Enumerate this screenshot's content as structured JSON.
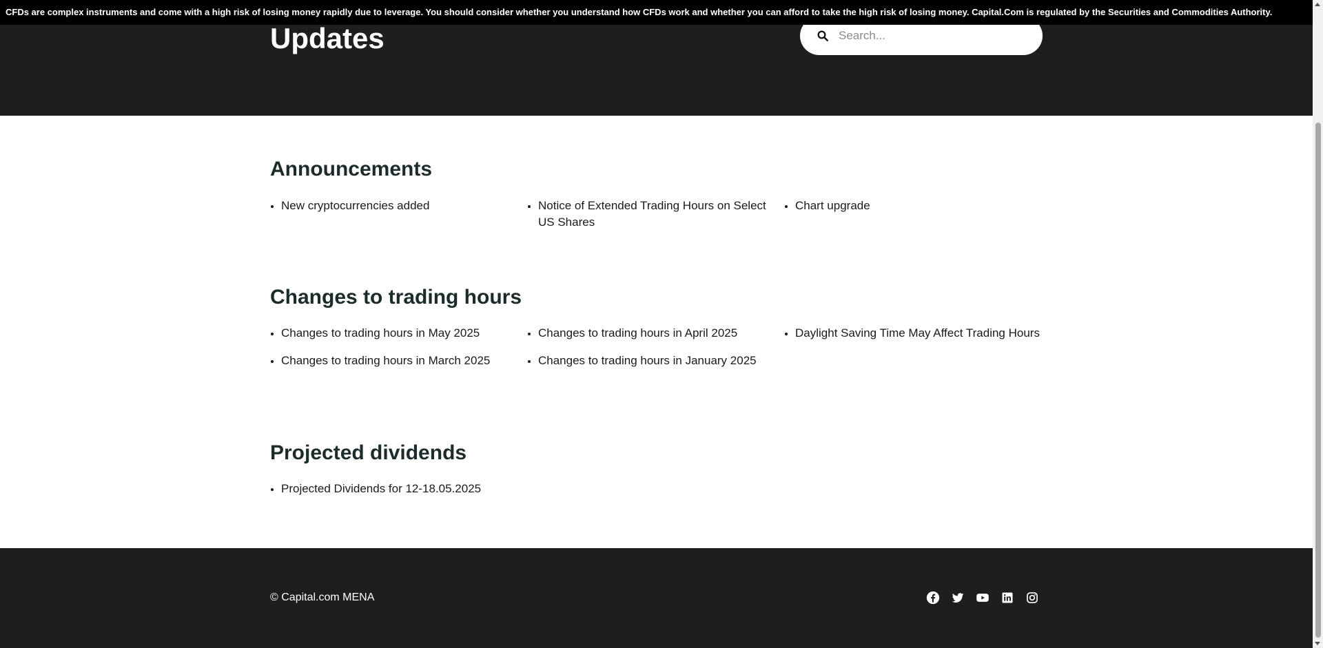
{
  "risk_warning": "CFDs are complex instruments and come with a high risk of losing money rapidly due to leverage. You should consider whether you understand how CFDs work and whether you can afford to take the high risk of losing money. Capital.Com is regulated by the Securities and Commodities Authority.",
  "hero": {
    "title": "Updates",
    "search_placeholder": "Search..."
  },
  "sections": [
    {
      "title": "Announcements",
      "links": [
        "New cryptocurrencies added",
        "Notice of Extended Trading Hours on Select US Shares",
        "Chart upgrade"
      ]
    },
    {
      "title": "Changes to trading hours",
      "links": [
        "Changes to trading hours in May 2025",
        "Changes to trading hours in April 2025",
        "Daylight Saving Time May Affect Trading Hours",
        "Changes to trading hours in March 2025",
        "Changes to trading hours in January 2025"
      ]
    },
    {
      "title": "Projected dividends",
      "links": [
        "Projected Dividends for 12-18.05.2025"
      ]
    }
  ],
  "footer": {
    "copyright": "© Capital.com MENA",
    "social": [
      "facebook-icon",
      "twitter-icon",
      "youtube-icon",
      "linkedin-icon",
      "instagram-icon"
    ]
  },
  "colors": {
    "dark_bg": "#1e1e1e",
    "risk_bar": "#000000",
    "heading": "#1c2b2b",
    "text": "#1a1a1a"
  }
}
